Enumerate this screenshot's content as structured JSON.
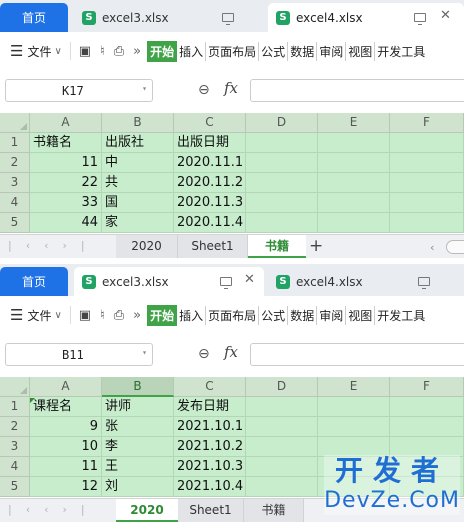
{
  "windows": [
    {
      "tabs": {
        "home": "首页",
        "doc1": "excel3.xlsx",
        "doc2": "excel4.xlsx",
        "active_doc": "doc2"
      },
      "menu": {
        "file": "文件",
        "ribbon": [
          "开始",
          "插入",
          "页面布局",
          "公式",
          "数据",
          "审阅",
          "视图",
          "开发工具"
        ]
      },
      "name_box": "K17",
      "fx": "fx",
      "columns": [
        "A",
        "B",
        "C",
        "D",
        "E",
        "F"
      ],
      "rows": [
        "1",
        "2",
        "3",
        "4",
        "5"
      ],
      "cells": [
        [
          "书籍名",
          "出版社",
          "出版日期",
          "",
          "",
          ""
        ],
        [
          "11",
          "中",
          "2020.11.1",
          "",
          "",
          ""
        ],
        [
          "22",
          "共",
          "2020.11.2",
          "",
          "",
          ""
        ],
        [
          "33",
          "国",
          "2020.11.3",
          "",
          "",
          ""
        ],
        [
          "44",
          "家",
          "2020.11.4",
          "",
          "",
          ""
        ]
      ],
      "sheets": [
        "2020",
        "Sheet1",
        "书籍"
      ],
      "active_sheet": "书籍",
      "add_sheet": "+"
    },
    {
      "tabs": {
        "home": "首页",
        "doc1": "excel3.xlsx",
        "doc2": "excel4.xlsx",
        "active_doc": "doc1"
      },
      "menu": {
        "file": "文件",
        "ribbon": [
          "开始",
          "插入",
          "页面布局",
          "公式",
          "数据",
          "审阅",
          "视图",
          "开发工具"
        ]
      },
      "name_box": "B11",
      "fx": "fx",
      "columns": [
        "A",
        "B",
        "C",
        "D",
        "E",
        "F"
      ],
      "rows": [
        "1",
        "2",
        "3",
        "4",
        "5"
      ],
      "cells": [
        [
          "课程名",
          "讲师",
          "发布日期",
          "",
          "",
          ""
        ],
        [
          "9",
          "张",
          "2021.10.1",
          "",
          "",
          ""
        ],
        [
          "10",
          "李",
          "2021.10.2",
          "",
          "",
          ""
        ],
        [
          "11",
          "王",
          "2021.10.3",
          "",
          "",
          ""
        ],
        [
          "12",
          "刘",
          "2021.10.4",
          "",
          "",
          ""
        ]
      ],
      "sheets": [
        "2020",
        "Sheet1",
        "书籍"
      ],
      "active_sheet": "2020"
    }
  ],
  "watermark": {
    "cn": "开发者",
    "en": "DevZe.CoM"
  },
  "colors": {
    "accent_green": "#41a348",
    "home_tab_blue": "#1f72e6",
    "cell_green": "#c7edcc",
    "excel_icon": "#21a366",
    "watermark_blue": "#1f6ed4"
  }
}
